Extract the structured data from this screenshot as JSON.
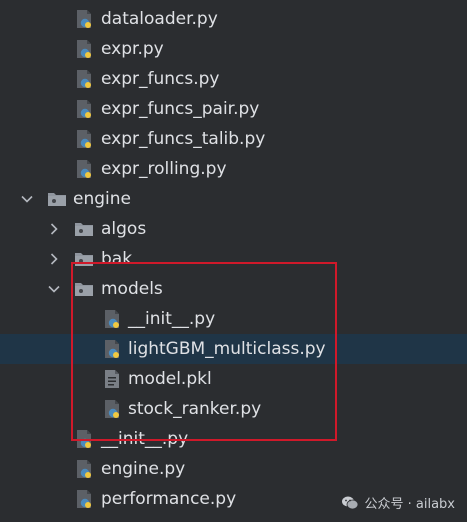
{
  "project_tree": {
    "items": [
      {
        "label": "dataloader.py",
        "type": "python",
        "depth": 2
      },
      {
        "label": "expr.py",
        "type": "python",
        "depth": 2
      },
      {
        "label": "expr_funcs.py",
        "type": "python",
        "depth": 2
      },
      {
        "label": "expr_funcs_pair.py",
        "type": "python",
        "depth": 2
      },
      {
        "label": "expr_funcs_talib.py",
        "type": "python",
        "depth": 2
      },
      {
        "label": "expr_rolling.py",
        "type": "python",
        "depth": 2
      },
      {
        "label": "engine",
        "type": "folder",
        "depth": 1,
        "expanded": true
      },
      {
        "label": "algos",
        "type": "folder",
        "depth": 2,
        "expanded": false
      },
      {
        "label": "bak",
        "type": "folder",
        "depth": 2,
        "expanded": false
      },
      {
        "label": "models",
        "type": "folder",
        "depth": 2,
        "expanded": true
      },
      {
        "label": "__init__.py",
        "type": "python",
        "depth": 3
      },
      {
        "label": "lightGBM_multiclass.py",
        "type": "python",
        "depth": 3,
        "selected": true
      },
      {
        "label": "model.pkl",
        "type": "file",
        "depth": 3
      },
      {
        "label": "stock_ranker.py",
        "type": "python",
        "depth": 3
      },
      {
        "label": "__init__.py",
        "type": "python",
        "depth": 2
      },
      {
        "label": "engine.py",
        "type": "python",
        "depth": 2
      },
      {
        "label": "performance.py",
        "type": "python",
        "depth": 2
      }
    ]
  },
  "watermark": {
    "text": "公众号 · ailabx",
    "icon": "wechat-icon"
  },
  "colors": {
    "background": "#2b2d30",
    "selected_row": "#1f3547",
    "highlight_box": "#d0192a",
    "text": "#dfe1e5",
    "python_blue": "#4b8bbe",
    "python_yellow": "#f0c840"
  }
}
